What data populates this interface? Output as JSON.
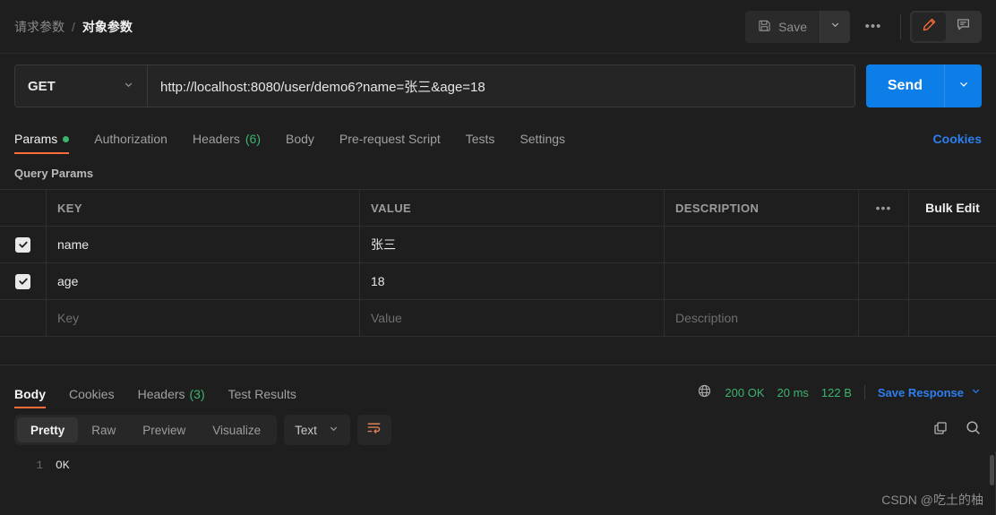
{
  "header": {
    "breadcrumb_parent": "请求参数",
    "breadcrumb_sep": "/",
    "breadcrumb_current": "对象参数",
    "save_label": "Save",
    "more_dots": "•••",
    "save_icon": "floppy-disk-icon",
    "caret_icon": "chevron-down-icon",
    "edit_icon": "pencil-icon",
    "comment_icon": "comment-icon"
  },
  "request": {
    "method": "GET",
    "method_caret": "chevron-down-icon",
    "url": "http://localhost:8080/user/demo6?name=张三&age=18",
    "send_label": "Send",
    "send_caret": "chevron-down-icon"
  },
  "request_tabs": [
    {
      "label": "Params",
      "dot": true,
      "active": true
    },
    {
      "label": "Authorization",
      "active": false
    },
    {
      "label": "Headers",
      "count": "(6)",
      "active": false
    },
    {
      "label": "Body",
      "active": false
    },
    {
      "label": "Pre-request Script",
      "active": false
    },
    {
      "label": "Tests",
      "active": false
    },
    {
      "label": "Settings",
      "active": false
    }
  ],
  "cookies_link": "Cookies",
  "query_params": {
    "title": "Query Params",
    "columns": {
      "key": "KEY",
      "value": "VALUE",
      "description": "DESCRIPTION",
      "dots": "•••",
      "bulk_edit": "Bulk Edit"
    },
    "rows": [
      {
        "checked": true,
        "key": "name",
        "value": "张三",
        "description": ""
      },
      {
        "checked": true,
        "key": "age",
        "value": "18",
        "description": ""
      }
    ],
    "placeholder_row": {
      "key": "Key",
      "value": "Value",
      "description": "Description"
    }
  },
  "response_tabs": [
    {
      "label": "Body",
      "active": true
    },
    {
      "label": "Cookies",
      "active": false
    },
    {
      "label": "Headers",
      "count": "(3)",
      "active": false
    },
    {
      "label": "Test Results",
      "active": false
    }
  ],
  "response_meta": {
    "globe_icon": "globe-icon",
    "status": "200 OK",
    "time": "20 ms",
    "size": "122 B",
    "save_response": "Save Response",
    "save_response_caret": "chevron-down-icon"
  },
  "view_bar": {
    "modes": [
      {
        "label": "Pretty",
        "active": true
      },
      {
        "label": "Raw",
        "active": false
      },
      {
        "label": "Preview",
        "active": false
      },
      {
        "label": "Visualize",
        "active": false
      }
    ],
    "format": "Text",
    "format_caret": "chevron-down-icon",
    "wrap_icon": "word-wrap-icon",
    "copy_icon": "copy-icon",
    "search_icon": "search-icon"
  },
  "response_body": {
    "line_number": "1",
    "content": "OK"
  },
  "watermark": "CSDN @吃土的柚",
  "colors": {
    "background": "#1e1e1e",
    "accent_orange": "#ff6c37",
    "link_blue": "#2d7fef",
    "send_blue": "#0d7ee8",
    "status_green": "#3cb46e"
  }
}
